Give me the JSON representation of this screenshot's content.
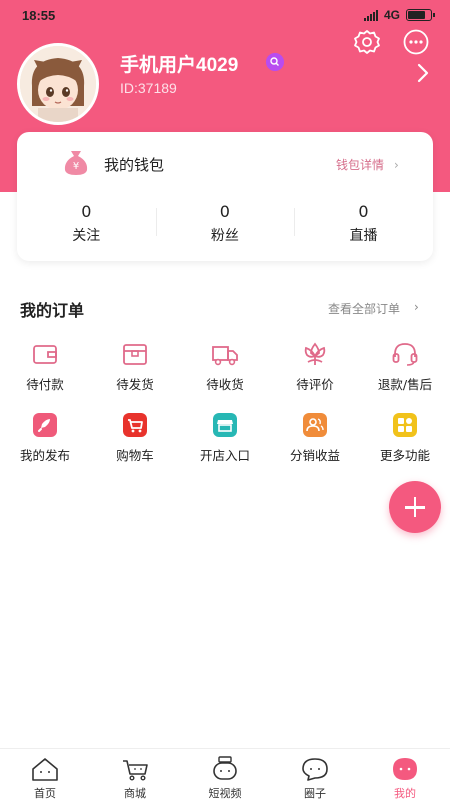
{
  "status_bar": {
    "time": "18:55",
    "network": "4G"
  },
  "profile": {
    "username": "手机用户4029",
    "user_id": "ID:37189"
  },
  "wallet": {
    "title": "我的钱包",
    "detail_link": "钱包详情",
    "chevron": "›"
  },
  "stats": [
    {
      "value": "0",
      "label": "关注"
    },
    {
      "value": "0",
      "label": "粉丝"
    },
    {
      "value": "0",
      "label": "直播"
    }
  ],
  "orders": {
    "title": "我的订单",
    "view_all": "查看全部订单",
    "chevron": "›",
    "items": [
      {
        "label": "待付款",
        "icon": "wallet-icon"
      },
      {
        "label": "待发货",
        "icon": "box-icon"
      },
      {
        "label": "待收货",
        "icon": "truck-icon"
      },
      {
        "label": "待评价",
        "icon": "flower-icon"
      },
      {
        "label": "退款/售后",
        "icon": "headset-icon"
      }
    ]
  },
  "features": [
    {
      "label": "我的发布",
      "icon": "rocket-icon",
      "color": "#ef5a7a"
    },
    {
      "label": "购物车",
      "icon": "cart-icon",
      "color": "#e8332c"
    },
    {
      "label": "开店入口",
      "icon": "store-icon",
      "color": "#27b7b4"
    },
    {
      "label": "分销收益",
      "icon": "users-icon",
      "color": "#f08c3a"
    },
    {
      "label": "更多功能",
      "icon": "grid-icon",
      "color": "#f1c21b"
    }
  ],
  "tabbar": [
    {
      "label": "首页",
      "icon": "home-icon",
      "active": false
    },
    {
      "label": "商城",
      "icon": "mall-icon",
      "active": false
    },
    {
      "label": "短视频",
      "icon": "video-icon",
      "active": false
    },
    {
      "label": "圈子",
      "icon": "chat-icon",
      "active": false
    },
    {
      "label": "我的",
      "icon": "profile-icon",
      "active": true
    }
  ],
  "colors": {
    "accent": "#f4597f",
    "order_icon": "#e06a8a",
    "link": "#d66e8b"
  }
}
